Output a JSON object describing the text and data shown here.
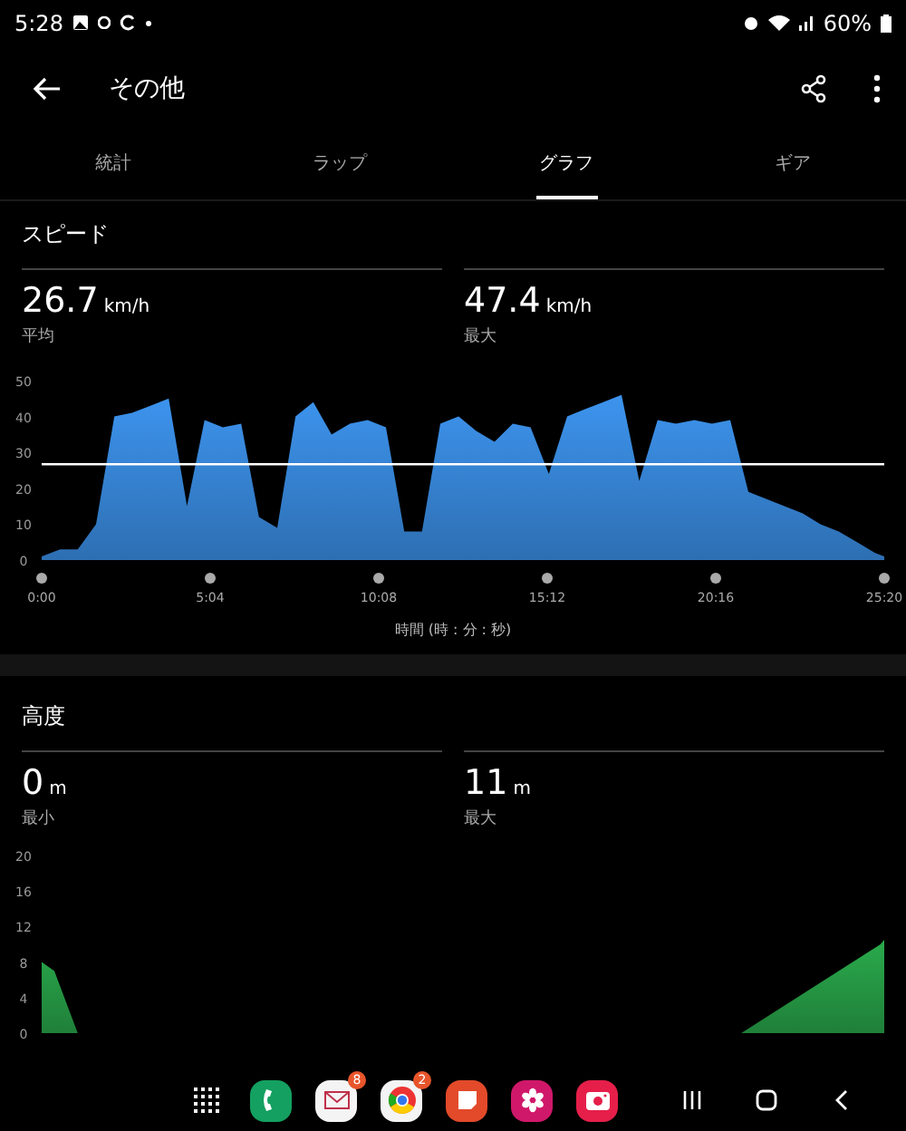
{
  "status_bar": {
    "time": "5:28",
    "battery": "60%"
  },
  "app_bar": {
    "title": "その他"
  },
  "tabs": [
    {
      "label": "統計",
      "selected": false
    },
    {
      "label": "ラップ",
      "selected": false
    },
    {
      "label": "グラフ",
      "selected": true
    },
    {
      "label": "ギア",
      "selected": false
    }
  ],
  "sections": [
    {
      "title": "スピード",
      "stats": [
        {
          "value": "26.7",
          "unit": "km/h",
          "label": "平均"
        },
        {
          "value": "47.4",
          "unit": "km/h",
          "label": "最大"
        }
      ],
      "chart_data": {
        "type": "area",
        "xlabel": "時間 (時 : 分 : 秒)",
        "x": [
          0,
          33,
          65,
          98,
          131,
          163,
          196,
          229,
          262,
          294,
          327,
          360,
          392,
          425,
          458,
          490,
          523,
          556,
          588,
          621,
          654,
          686,
          719,
          752,
          784,
          817,
          850,
          882,
          915,
          948,
          980,
          1013,
          1046,
          1078,
          1111,
          1144,
          1177,
          1209,
          1242,
          1275,
          1307,
          1340,
          1373,
          1405,
          1438,
          1471,
          1503,
          1520
        ],
        "series": [
          {
            "color": "#3d94ee",
            "values": [
              1,
              3,
              3,
              10,
              40,
              41,
              43,
              45,
              15,
              39,
              37,
              38,
              12,
              9,
              40,
              44,
              35,
              38,
              39,
              37,
              8,
              8,
              38,
              40,
              36,
              33,
              38,
              37,
              24,
              40,
              42,
              44,
              46,
              22,
              39,
              38,
              39,
              38,
              39,
              19,
              17,
              15,
              13,
              10,
              8,
              5,
              2,
              1
            ]
          }
        ],
        "xlim": [
          0,
          1520
        ],
        "ylim": [
          0,
          50
        ],
        "xticks": [
          {
            "value": 0,
            "label": "0:00"
          },
          {
            "value": 304,
            "label": "5:04"
          },
          {
            "value": 608,
            "label": "10:08"
          },
          {
            "value": 912,
            "label": "15:12"
          },
          {
            "value": 1216,
            "label": "20:16"
          },
          {
            "value": 1520,
            "label": "25:20"
          }
        ],
        "yticks": [
          0,
          10,
          20,
          30,
          40,
          50
        ],
        "ref_lines": [
          {
            "axis": "y",
            "value": 26.7
          }
        ]
      }
    },
    {
      "title": "高度",
      "stats": [
        {
          "value": "0",
          "unit": "m",
          "label": "最小"
        },
        {
          "value": "11",
          "unit": "m",
          "label": "最大"
        }
      ],
      "chart_data": {
        "type": "area",
        "x": [
          0,
          23,
          65,
          1262,
          1513,
          1520
        ],
        "series": [
          {
            "color": "#2aaa4c",
            "values": [
              8,
              7,
              0,
              0,
              10,
              10.5
            ]
          }
        ],
        "xlim": [
          0,
          1520
        ],
        "ylim": [
          0,
          20
        ],
        "yticks": [
          0,
          4,
          8,
          12,
          16,
          20
        ]
      }
    }
  ],
  "dock": [
    {
      "kind": "apps"
    },
    {
      "kind": "phone"
    },
    {
      "kind": "mail",
      "badge": "8"
    },
    {
      "kind": "browser",
      "badge": "2"
    },
    {
      "kind": "notes"
    },
    {
      "kind": "flower"
    },
    {
      "kind": "camera"
    }
  ]
}
